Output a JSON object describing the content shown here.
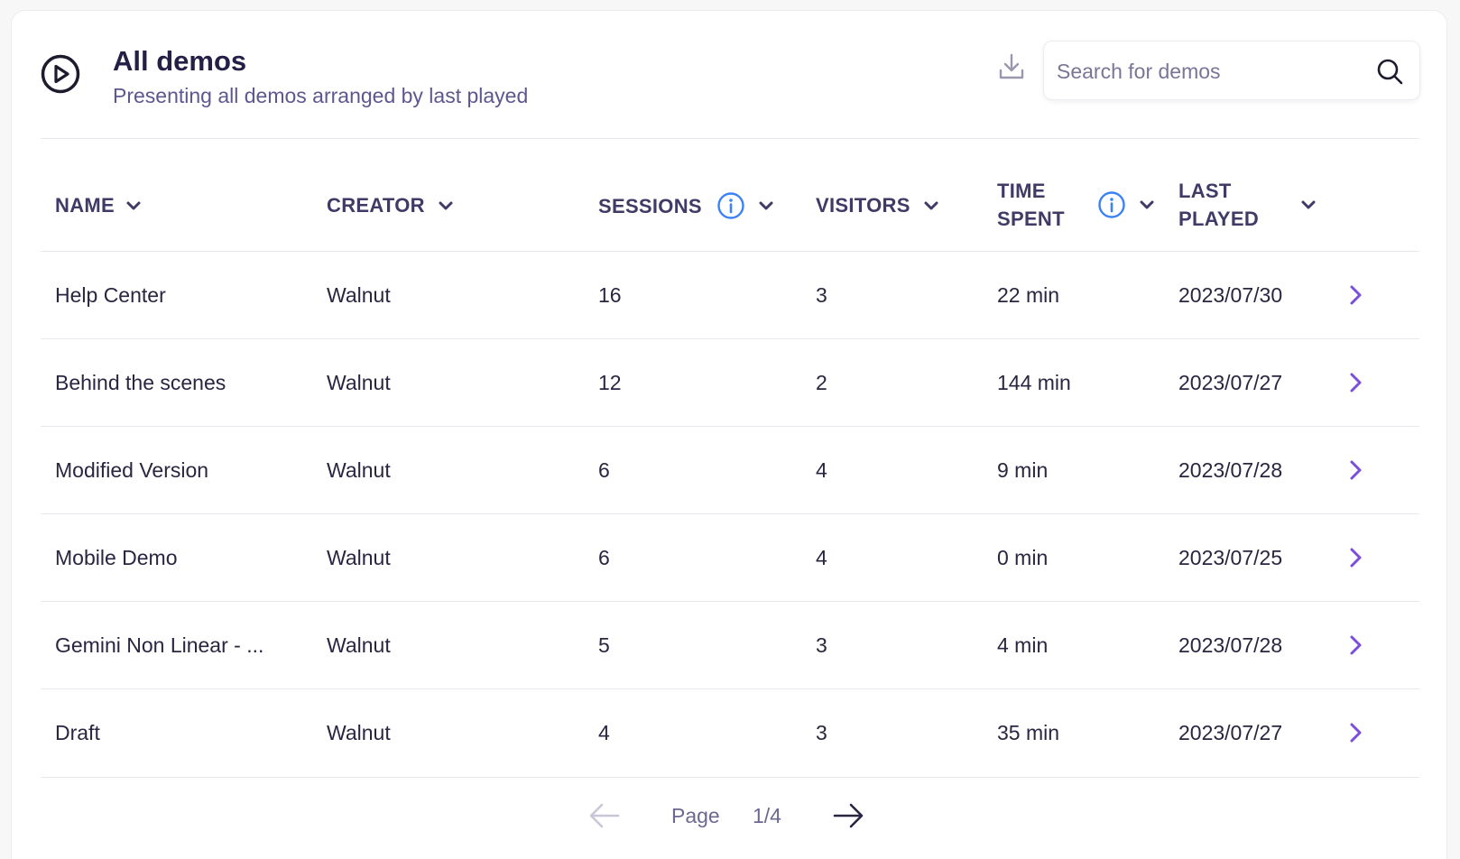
{
  "header": {
    "title": "All demos",
    "subtitle": "Presenting all demos arranged by last played",
    "play_icon": "play-circle-icon",
    "download_icon": "download-icon"
  },
  "search": {
    "placeholder": "Search for demos",
    "value": "",
    "icon": "search-icon"
  },
  "table": {
    "columns": {
      "name": "NAME",
      "creator": "CREATOR",
      "sessions": "SESSIONS",
      "visitors": "VISITORS",
      "time_spent_1": "TIME",
      "time_spent_2": "SPENT",
      "last_played_1": "LAST",
      "last_played_2": "PLAYED"
    },
    "rows": [
      {
        "name": "Help Center",
        "creator": "Walnut",
        "sessions": "16",
        "visitors": "3",
        "time_spent": "22 min",
        "last_played": "2023/07/30"
      },
      {
        "name": "Behind the scenes",
        "creator": "Walnut",
        "sessions": "12",
        "visitors": "2",
        "time_spent": "144 min",
        "last_played": "2023/07/27"
      },
      {
        "name": "Modified Version",
        "creator": "Walnut",
        "sessions": "6",
        "visitors": "4",
        "time_spent": "9 min",
        "last_played": "2023/07/28"
      },
      {
        "name": "Mobile Demo",
        "creator": "Walnut",
        "sessions": "6",
        "visitors": "4",
        "time_spent": "0 min",
        "last_played": "2023/07/25"
      },
      {
        "name": "Gemini Non Linear - ...",
        "creator": "Walnut",
        "sessions": "5",
        "visitors": "3",
        "time_spent": "4 min",
        "last_played": "2023/07/28"
      },
      {
        "name": "Draft",
        "creator": "Walnut",
        "sessions": "4",
        "visitors": "3",
        "time_spent": "35 min",
        "last_played": "2023/07/27"
      }
    ]
  },
  "pagination": {
    "label": "Page",
    "current": "1/4"
  },
  "colors": {
    "title": "#241f45",
    "subtitle": "#5d5790",
    "header_text": "#3f3a66",
    "info_icon": "#3b82f6",
    "row_chevron": "#7c4ddc",
    "divider": "#e8e7ee"
  }
}
